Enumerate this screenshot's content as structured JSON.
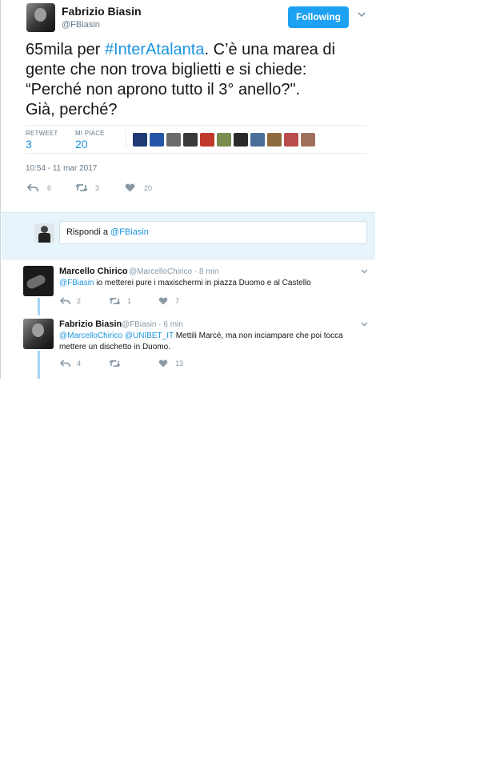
{
  "tweet": {
    "author_name": "Fabrizio Biasin",
    "author_handle": "@FBiasin",
    "follow_label": "Following",
    "text_line1_prefix": "65mila per ",
    "hashtag": "#InterAtalanta",
    "text_line1_suffix": ". C’è una marea di",
    "text_line2": "gente che non trova biglietti e si chiede:",
    "text_line3": "“Perché non aprono tutto il 3° anello?\".",
    "text_line4": "Già, perché?",
    "retweets_label": "RETWEET",
    "retweets_count": "3",
    "likes_label": "MI PIACE",
    "likes_count": "20",
    "timestamp": "10:54 - 11 mar 2017",
    "reply_count": "6",
    "retweet_action_count": "3",
    "like_action_count": "20"
  },
  "likers": [
    {
      "name": "liker-1",
      "color": "#1f3b73"
    },
    {
      "name": "liker-2",
      "color": "#2456a8"
    },
    {
      "name": "liker-3",
      "color": "#6b6b6b"
    },
    {
      "name": "liker-4",
      "color": "#3a3a3a"
    },
    {
      "name": "liker-5",
      "color": "#c0392b"
    },
    {
      "name": "liker-6",
      "color": "#7a8c4e"
    },
    {
      "name": "liker-7",
      "color": "#2b2b2b"
    },
    {
      "name": "liker-8",
      "color": "#4a6e9a"
    },
    {
      "name": "liker-9",
      "color": "#8e6b3e"
    },
    {
      "name": "liker-10",
      "color": "#b94c4c"
    },
    {
      "name": "liker-11",
      "color": "#a0715a"
    }
  ],
  "reply_box": {
    "prefix": "Rispondi a ",
    "mention": "@FBiasin"
  },
  "replies": [
    {
      "name": "Marcello Chirico",
      "meta": "@MarcelloChirico · 8 min",
      "mention": "@FBiasin",
      "text": " io metterei pure i maxischermi in piazza Duomo e al Castello",
      "reply_count": "2",
      "retweet_count": "1",
      "like_count": "7"
    },
    {
      "name": "Fabrizio Biasin",
      "meta": "@FBiasin · 6 min",
      "mention": "@MarcelloChirico @UNIBET_IT",
      "text": " Mettili Marcé, ma non inciampare che poi tocca",
      "text_line2": "mettere un dischetto in Duomo.",
      "reply_count": "4",
      "retweet_count": "",
      "like_count": "13"
    }
  ],
  "colors": {
    "accent": "#1da1f2",
    "link": "#1b95e0",
    "muted": "#8899a6",
    "reply_bg": "#e8f4fb"
  }
}
